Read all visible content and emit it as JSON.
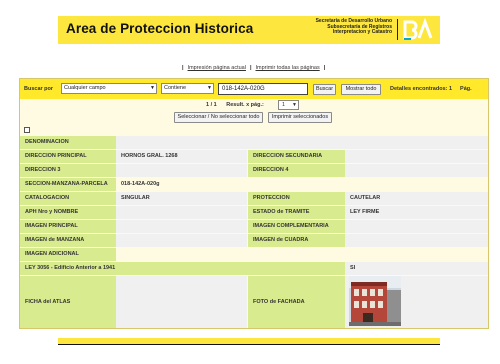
{
  "banner": {
    "title": "Area de Proteccion Historica",
    "dept": "Secretaria de Desarrollo Urbano\nSubsecretaría de Registros\nInterpretacion y Catastro",
    "logo_alt": "BA"
  },
  "print_links": {
    "current": "Impresión página actual",
    "all": "Imprimir todas las páginas",
    "separator": "|"
  },
  "search": {
    "label": "Buscar por",
    "field_value": "Cualquier campo",
    "mode_value": "Contiene",
    "query_value": "018-142A-020G",
    "search_button": "Buscar",
    "show_all_button": "Mostrar todo",
    "found_text": "Detalles encontrados: 1",
    "page_label": "Pág."
  },
  "pager": {
    "position": "1 / 1",
    "results_label": "Result. x pág.:",
    "per_page": "1"
  },
  "actions": {
    "select_toggle": "Seleccionar / No seleccionar todo",
    "print_selected": "Imprimir seleccionados"
  },
  "record": {
    "denominacion_label": "DENOMINACION",
    "direccion_principal_label": "DIRECCION PRINCIPAL",
    "direccion_principal": "HORNOS GRAL. 1268",
    "direccion_secundaria_label": "DIRECCION SECUNDARIA",
    "direccion3_label": "DIRECCION 3",
    "direccion4_label": "DIRECCION 4",
    "smp_label": "SECCION-MANZANA-PARCELA",
    "smp": "018-142A-020g",
    "catalogacion_label": "CATALOGACION",
    "catalogacion": "SINGULAR",
    "proteccion_label": "PROTECCION",
    "proteccion": "CAUTELAR",
    "aph_label": "APH Nro y NOMBRE",
    "estado_label": "ESTADO de TRAMITE",
    "estado": "LEY FIRME",
    "imagen_principal_label": "IMAGEN PRINCIPAL",
    "imagen_complementaria_label": "IMAGEN COMPLEMENTARIA",
    "imagen_manzana_label": "IMAGEN de MANZANA",
    "imagen_cuadra_label": "IMAGEN de CUADRA",
    "imagen_adicional_label": "IMAGEN ADICIONAL",
    "ley_label": "LEY 3056 - Edificio Anterior a 1941",
    "ley_value": "SI",
    "ficha_label": "FICHA del ATLAS",
    "foto_label": "FOTO de FACHADA"
  },
  "colors": {
    "brand_yellow": "#fde63d",
    "label_green": "#d9eb8f",
    "value_grey": "#f0f0f0"
  }
}
